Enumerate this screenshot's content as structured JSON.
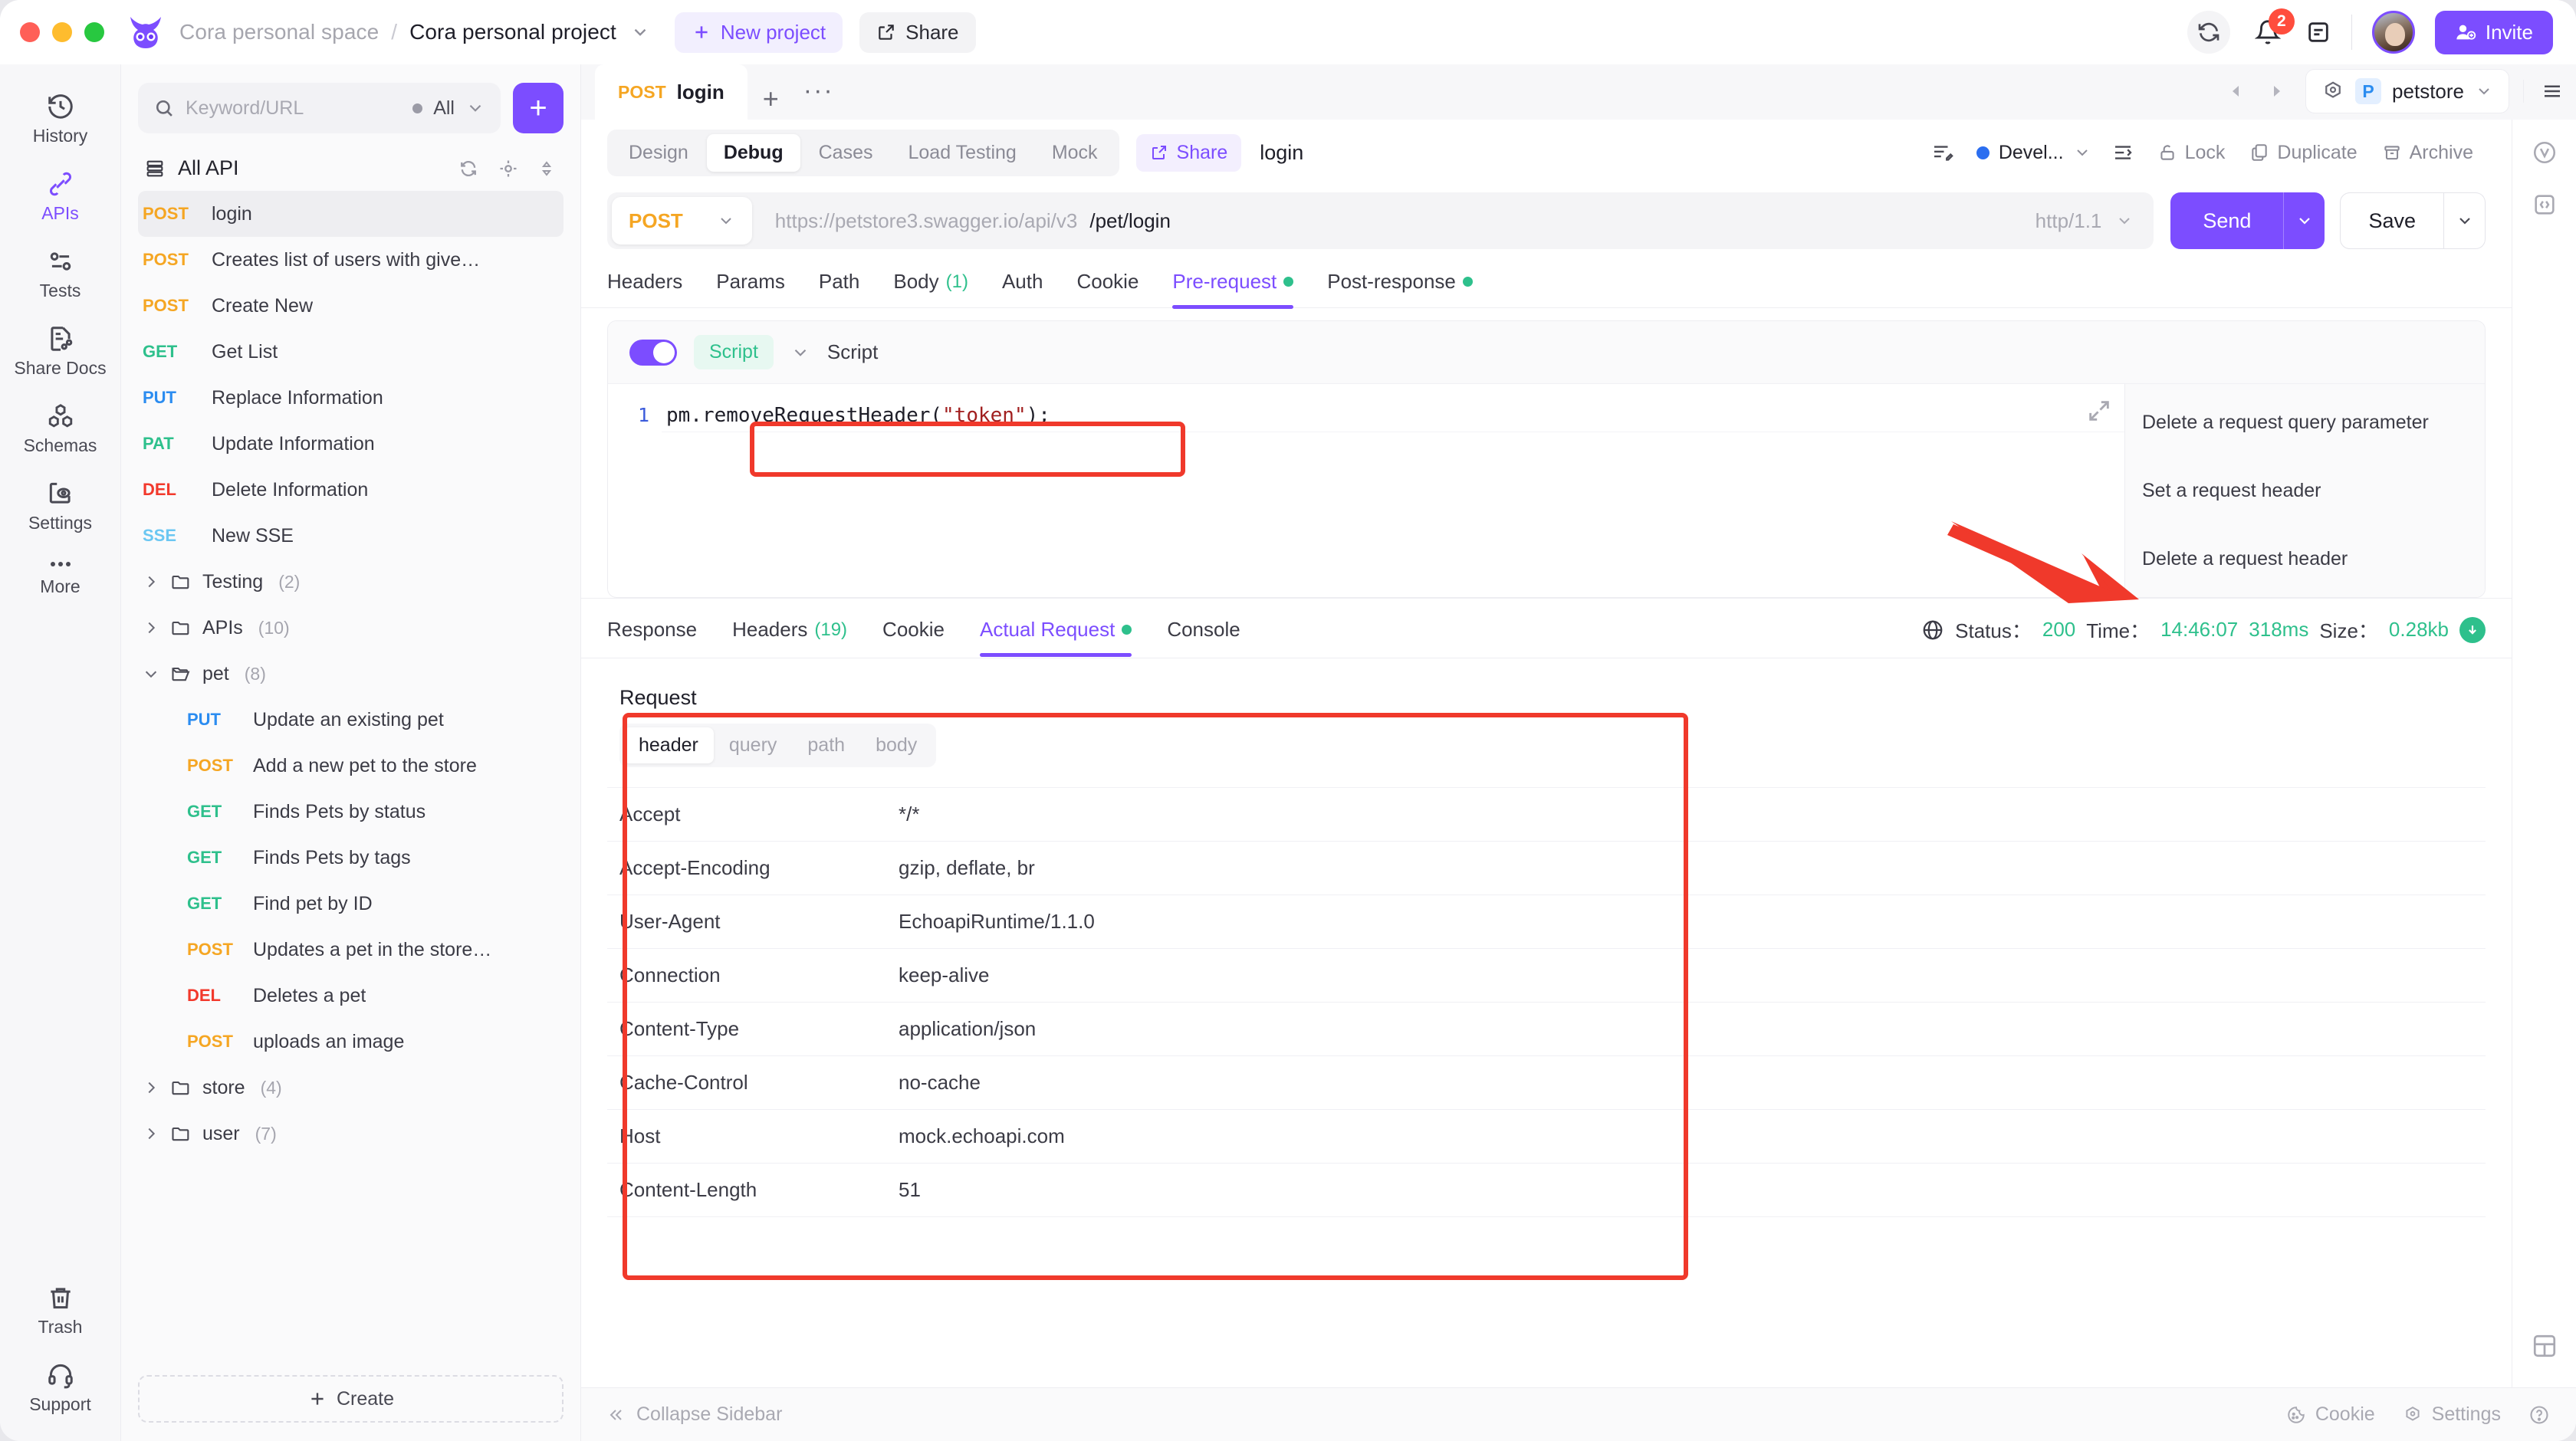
{
  "topbar": {
    "space": "Cora personal space",
    "separator": "/",
    "project": "Cora personal project",
    "new_project": "New project",
    "share": "Share",
    "notification_count": "2",
    "invite": "Invite"
  },
  "rail": {
    "items": [
      {
        "label": "History",
        "icon": "history-icon",
        "active": false
      },
      {
        "label": "APIs",
        "icon": "apis-icon",
        "active": true
      },
      {
        "label": "Tests",
        "icon": "tests-icon",
        "active": false
      },
      {
        "label": "Share Docs",
        "icon": "share-docs-icon",
        "active": false
      },
      {
        "label": "Schemas",
        "icon": "schemas-icon",
        "active": false
      },
      {
        "label": "Settings",
        "icon": "settings-icon",
        "active": false
      },
      {
        "label": "More",
        "icon": "more-icon",
        "active": false
      }
    ],
    "bottom": [
      {
        "label": "Trash",
        "icon": "trash-icon"
      },
      {
        "label": "Support",
        "icon": "support-icon"
      }
    ]
  },
  "apilist": {
    "search_placeholder": "Keyword/URL",
    "filter": "All",
    "add": "+",
    "header": "All API",
    "create": "Create",
    "items": [
      {
        "kind": "api",
        "method": "POST",
        "cls": "post",
        "name": "login",
        "selected": true
      },
      {
        "kind": "api",
        "method": "POST",
        "cls": "post",
        "name": "Creates list of users with give…"
      },
      {
        "kind": "api",
        "method": "POST",
        "cls": "post",
        "name": "Create New"
      },
      {
        "kind": "api",
        "method": "GET",
        "cls": "get",
        "name": "Get List"
      },
      {
        "kind": "api",
        "method": "PUT",
        "cls": "put",
        "name": "Replace Information"
      },
      {
        "kind": "api",
        "method": "PAT",
        "cls": "pat",
        "name": "Update Information"
      },
      {
        "kind": "api",
        "method": "DEL",
        "cls": "del",
        "name": "Delete Information"
      },
      {
        "kind": "api",
        "method": "SSE",
        "cls": "sse",
        "name": "New SSE"
      },
      {
        "kind": "folder",
        "name": "Testing",
        "count": "(2)",
        "open": false
      },
      {
        "kind": "folder",
        "name": "APIs",
        "count": "(10)",
        "open": false
      },
      {
        "kind": "folder",
        "name": "pet",
        "count": "(8)",
        "open": true
      },
      {
        "kind": "api",
        "method": "PUT",
        "cls": "put",
        "name": "Update an existing pet",
        "nested": true
      },
      {
        "kind": "api",
        "method": "POST",
        "cls": "post",
        "name": "Add a new pet to the store",
        "nested": true
      },
      {
        "kind": "api",
        "method": "GET",
        "cls": "get",
        "name": "Finds Pets by status",
        "nested": true
      },
      {
        "kind": "api",
        "method": "GET",
        "cls": "get",
        "name": "Finds Pets by tags",
        "nested": true
      },
      {
        "kind": "api",
        "method": "GET",
        "cls": "get",
        "name": "Find pet by ID",
        "nested": true
      },
      {
        "kind": "api",
        "method": "POST",
        "cls": "post",
        "name": "Updates a pet in the store…",
        "nested": true
      },
      {
        "kind": "api",
        "method": "DEL",
        "cls": "del",
        "name": "Deletes a pet",
        "nested": true
      },
      {
        "kind": "api",
        "method": "POST",
        "cls": "post",
        "name": "uploads an image",
        "nested": true
      },
      {
        "kind": "folder",
        "name": "store",
        "count": "(4)",
        "open": false
      },
      {
        "kind": "folder",
        "name": "user",
        "count": "(7)",
        "open": false
      }
    ]
  },
  "tabstrip": {
    "doc_method": "POST",
    "doc_title": "login",
    "plus": "+",
    "dots": "···",
    "env_letter": "P",
    "env_name": "petstore"
  },
  "modebar": {
    "segments": [
      {
        "label": "Design",
        "on": false
      },
      {
        "label": "Debug",
        "on": true
      },
      {
        "label": "Cases",
        "on": false
      },
      {
        "label": "Load Testing",
        "on": false
      },
      {
        "label": "Mock",
        "on": false
      }
    ],
    "share": "Share",
    "api_name": "login",
    "status": "Devel...",
    "status_color": "#2b6ef0",
    "actions": [
      {
        "label": "Lock",
        "icon": "lock-icon"
      },
      {
        "label": "Duplicate",
        "icon": "duplicate-icon"
      },
      {
        "label": "Archive",
        "icon": "archive-icon"
      }
    ]
  },
  "urlbar": {
    "method": "POST",
    "host": "https://petstore3.swagger.io/api/v3",
    "path": "/pet/login",
    "protocol": "http/1.1",
    "send": "Send",
    "save": "Save"
  },
  "request_tabs": [
    {
      "label": "Headers",
      "count": "",
      "dot": false,
      "on": false
    },
    {
      "label": "Params",
      "count": "",
      "dot": false,
      "on": false
    },
    {
      "label": "Path",
      "count": "",
      "dot": false,
      "on": false
    },
    {
      "label": "Body",
      "count": "(1)",
      "dot": false,
      "on": false
    },
    {
      "label": "Auth",
      "count": "",
      "dot": false,
      "on": false
    },
    {
      "label": "Cookie",
      "count": "",
      "dot": false,
      "on": false
    },
    {
      "label": "Pre-request",
      "count": "",
      "dot": true,
      "on": true
    },
    {
      "label": "Post-response",
      "count": "",
      "dot": true,
      "on": false
    }
  ],
  "script": {
    "chip": "Script",
    "label": "Script",
    "line_number": "1",
    "code_prefix": "pm.removeRequestHeader(",
    "code_string": "\"token\"",
    "code_suffix": ");",
    "autocomplete": [
      "Delete a request query parameter",
      "Set a request header",
      "Delete a request header"
    ]
  },
  "response_tabs": [
    {
      "label": "Response",
      "count": "",
      "dot": false,
      "on": false
    },
    {
      "label": "Headers",
      "count": "(19)",
      "dot": false,
      "on": false
    },
    {
      "label": "Cookie",
      "count": "",
      "dot": false,
      "on": false
    },
    {
      "label": "Actual Request",
      "count": "",
      "dot": true,
      "on": true
    },
    {
      "label": "Console",
      "count": "",
      "dot": false,
      "on": false
    }
  ],
  "status": {
    "status_label": "Status：",
    "status_value": "200",
    "time_label": "Time：",
    "time_value": "14:46:07",
    "duration": "318ms",
    "size_label": "Size：",
    "size_value": "0.28kb"
  },
  "request_panel": {
    "title": "Request",
    "subtabs": [
      {
        "label": "header",
        "on": true
      },
      {
        "label": "query",
        "on": false
      },
      {
        "label": "path",
        "on": false
      },
      {
        "label": "body",
        "on": false
      }
    ],
    "headers": [
      {
        "key": "Accept",
        "value": "*/*"
      },
      {
        "key": "Accept-Encoding",
        "value": "gzip, deflate, br"
      },
      {
        "key": "User-Agent",
        "value": "EchoapiRuntime/1.1.0"
      },
      {
        "key": "Connection",
        "value": "keep-alive"
      },
      {
        "key": "Content-Type",
        "value": "application/json"
      },
      {
        "key": "Cache-Control",
        "value": "no-cache"
      },
      {
        "key": "Host",
        "value": "mock.echoapi.com"
      },
      {
        "key": "Content-Length",
        "value": "51"
      }
    ]
  },
  "bottombar": {
    "collapse": "Collapse Sidebar",
    "cookie": "Cookie",
    "settings": "Settings"
  },
  "colors": {
    "accent": "#7c4dff",
    "post": "#f5a623",
    "get": "#2ec08c",
    "put": "#2b8cf0",
    "del": "#f2392c",
    "sse": "#6bc7f2",
    "annotation": "#f0392b"
  }
}
